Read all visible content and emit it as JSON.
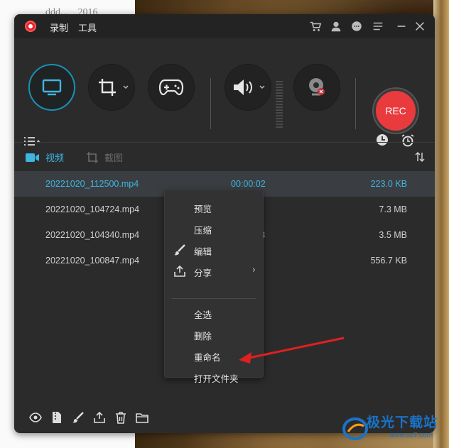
{
  "background": {
    "text": "ddd..., , 2016"
  },
  "titlebar": {
    "menus": [
      "录制",
      "工具"
    ]
  },
  "toolbar": {
    "rec_label": "REC"
  },
  "tabs": [
    {
      "label": "视频"
    },
    {
      "label": "截图"
    }
  ],
  "files": [
    {
      "name": "20221020_112500.mp4",
      "duration": "00:00:02",
      "size": "223.0 KB"
    },
    {
      "name": "20221020_104724.mp4",
      "duration": "",
      "size": "7.3 MB"
    },
    {
      "name": "20221020_104340.mp4",
      "duration": "3",
      "size": "3.5 MB"
    },
    {
      "name": "20221020_100847.mp4",
      "duration": "",
      "size": "556.7 KB"
    }
  ],
  "context_menu": {
    "items": [
      {
        "label": "预览"
      },
      {
        "label": "压缩"
      },
      {
        "label": "编辑"
      },
      {
        "label": "分享"
      },
      {
        "label": "全选"
      },
      {
        "label": "删除"
      },
      {
        "label": "重命名"
      },
      {
        "label": "打开文件夹"
      }
    ]
  },
  "watermark": {
    "text": "极光下载站",
    "url": "www.xz7.com"
  },
  "colors": {
    "accent": "#3fb6e0",
    "rec": "#e93a3e",
    "window_bg": "#2b2b2c",
    "annotation": "#e02020"
  }
}
